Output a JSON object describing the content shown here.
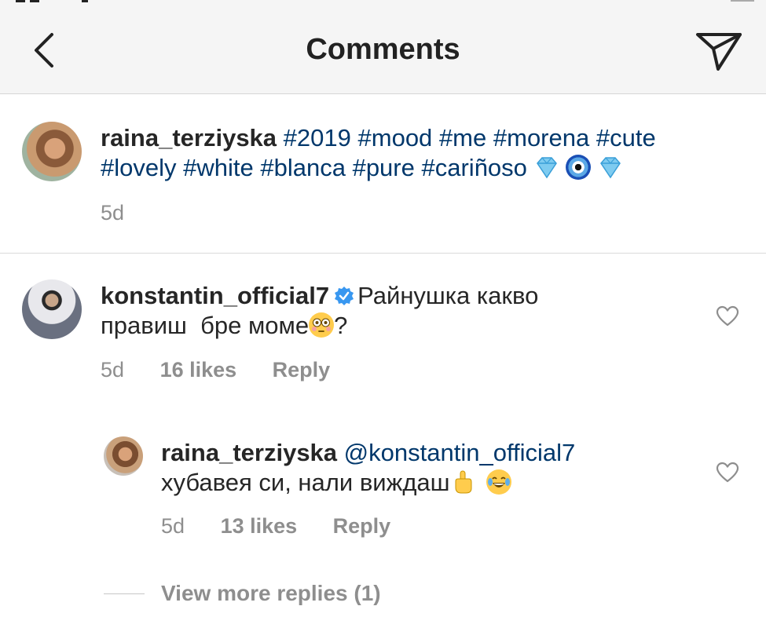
{
  "header": {
    "title": "Comments",
    "back_icon": "chevron-left-icon",
    "share_icon": "paper-plane-icon"
  },
  "caption": {
    "username": "raina_terziyska",
    "hashtags_line1": [
      "#2019",
      "#mood",
      "#me",
      "#morena",
      "#cute"
    ],
    "hashtags_line2": [
      "#lovely",
      "#white",
      "#blanca",
      "#pure",
      "#cariñoso"
    ],
    "emojis": [
      "gem-emoji",
      "nazar-amulet-emoji",
      "gem-emoji"
    ],
    "time": "5d"
  },
  "comments": [
    {
      "username": "konstantin_official7",
      "verified": true,
      "text_line1": "Райнушка какво",
      "text_line2": "правиш  бре моме",
      "text_end": "?",
      "emoji": "flushed-face-emoji",
      "time": "5d",
      "likes": "16 likes",
      "reply_label": "Reply"
    }
  ],
  "replies": [
    {
      "username": "raina_terziyska",
      "mention": "@konstantin_official7",
      "text": "хубавея си, нали виждаш",
      "emojis": [
        "pointing-up-emoji",
        "tears-of-joy-emoji"
      ],
      "time": "5d",
      "likes": "13 likes",
      "reply_label": "Reply"
    }
  ],
  "view_more_replies": "View more replies (1)",
  "colors": {
    "hashtag": "#00376b",
    "meta": "#8e8e8e",
    "text": "#262626",
    "verified": "#3897f0"
  }
}
